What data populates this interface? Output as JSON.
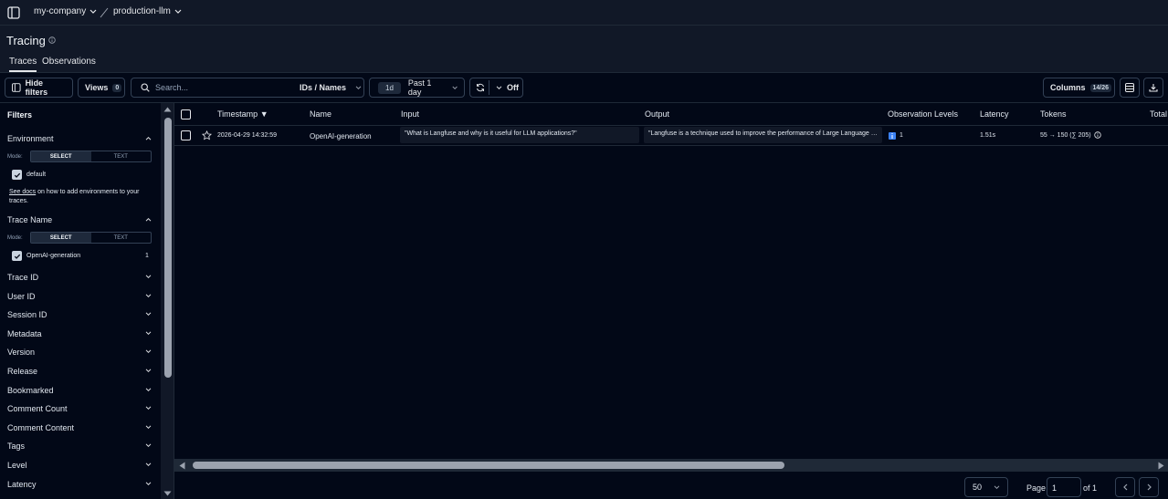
{
  "breadcrumb": {
    "org": "my-company",
    "project": "production-llm"
  },
  "page": {
    "title": "Tracing"
  },
  "tabs": [
    {
      "label": "Traces",
      "active": true
    },
    {
      "label": "Observations",
      "active": false
    }
  ],
  "toolbar": {
    "hide_filters_label": "Hide filters",
    "views_label": "Views",
    "views_count": "0",
    "search_placeholder": "Search...",
    "search_scope": "IDs / Names",
    "time_badge": "1d",
    "time_range": "Past 1 day",
    "refresh_label": "Off",
    "columns_label": "Columns",
    "columns_count": "14/26"
  },
  "filters": {
    "heading": "Filters",
    "mode_label": "Mode:",
    "mode_options": [
      "SELECT",
      "TEXT"
    ],
    "environment": {
      "label": "Environment",
      "option": "default",
      "docs_link": "See docs",
      "docs_text": " on how to add environments to your traces."
    },
    "trace_name": {
      "label": "Trace Name",
      "option": "OpenAI-generation",
      "count": "1"
    },
    "collapsed": [
      "Trace ID",
      "User ID",
      "Session ID",
      "Metadata",
      "Version",
      "Release",
      "Bookmarked",
      "Comment Count",
      "Comment Content",
      "Tags",
      "Level",
      "Latency"
    ]
  },
  "table": {
    "columns": [
      "Timestamp",
      "Name",
      "Input",
      "Output",
      "Observation Levels",
      "Latency",
      "Tokens",
      "Total"
    ],
    "sort_indicator": "▼",
    "rows": [
      {
        "timestamp": "2026-04-29 14:32:59",
        "name": "OpenAI-generation",
        "input": "\"What is Langfuse and why is it useful for LLM applications?\"",
        "output": "\"Langfuse is a technique used to improve the performance of Large Language Models",
        "observation_level": "1",
        "latency": "1.51s",
        "tokens": "55 → 150 (∑ 205)"
      }
    ]
  },
  "pagination": {
    "page_size": "50",
    "page_label": "Page",
    "page": "1",
    "of_label": "of 1"
  },
  "colors": {
    "background": "#020817",
    "panel": "#111827",
    "border": "#334155",
    "level_badge": "#3b82f6"
  }
}
